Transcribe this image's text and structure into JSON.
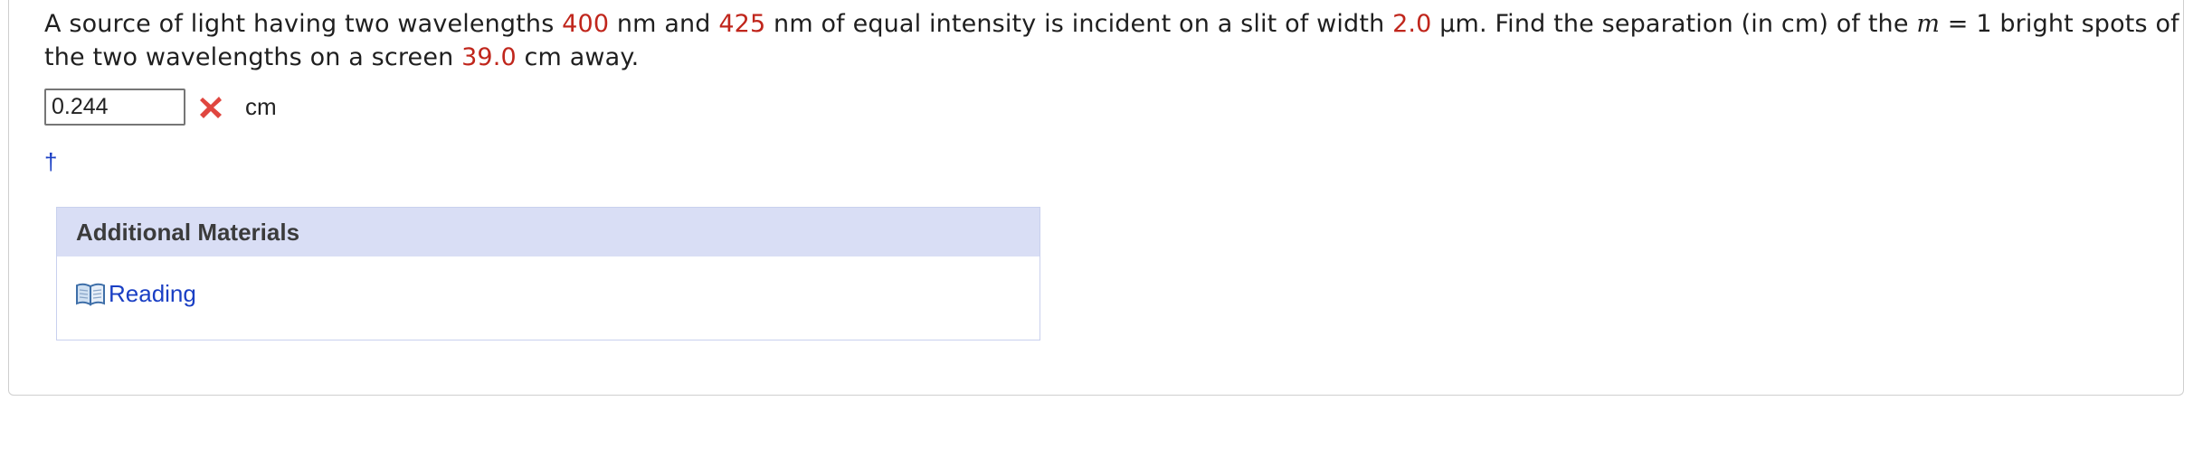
{
  "question": {
    "t1": "A source of light having two wavelengths ",
    "wavelength_1": "400",
    "t2": " nm and ",
    "wavelength_2": "425",
    "t3": " nm of equal intensity is incident on a slit of width ",
    "slit_width": "2.0",
    "t4": " μm. Find the separation (in cm) of the ",
    "var_m": "m",
    "t5": " = 1 bright spots of the two wavelengths on a screen ",
    "distance": "39.0",
    "t6": " cm away."
  },
  "answer": {
    "value": "0.244",
    "status": "incorrect",
    "status_icon": "x-icon",
    "unit": "cm"
  },
  "dagger_link": "†",
  "additional_materials": {
    "title": "Additional Materials",
    "items": [
      {
        "icon": "book-icon",
        "label": "Reading"
      }
    ]
  },
  "colors": {
    "given_value": "#c0261c",
    "link": "#1a3fc4",
    "wrong_mark": "#e0463f",
    "materials_header_bg": "#d9def5"
  }
}
